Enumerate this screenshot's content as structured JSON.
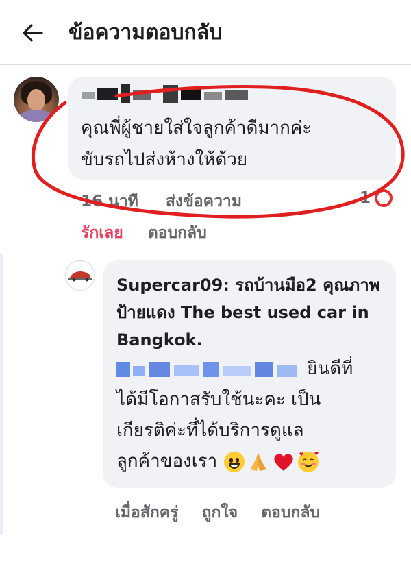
{
  "header": {
    "title": "ข้อความตอบกลับ",
    "back_icon": "arrow-left-icon"
  },
  "comment": {
    "author_redacted": true,
    "text_line1": "คุณพี่ผู้ชายใส่ใจลูกค้าดีมากค่ะ",
    "text_line2": "ขับรถไปส่งห้างให้ด้วย",
    "time": "16 นาที",
    "send_message": "ส่งข้อความ",
    "reaction_count": "1",
    "love_action": "รักเลย",
    "reply_action": "ตอบกลับ",
    "love_color": "#e4405f",
    "annotation_color": "#e02020"
  },
  "reply": {
    "author": "Supercar09: รถบ้านมือ2 คุณภาพป้ายแดง The best used car in Bangkok.",
    "text_after_mention": "ยินดีที่",
    "text_line2": "ได้มีโอกาสรับใช้นะคะ เป็น",
    "text_line3": "เกียรติค่ะที่ได้บริการดูแล",
    "text_line4": "ลูกค้าของเรา",
    "emojis": [
      "grinning-face-icon",
      "folded-hands-icon",
      "red-heart-icon",
      "smiling-face-with-hearts-icon"
    ],
    "time": "เมื่อสักครู่",
    "like_action": "ถูกใจ",
    "reply_action": "ตอบกลับ"
  }
}
